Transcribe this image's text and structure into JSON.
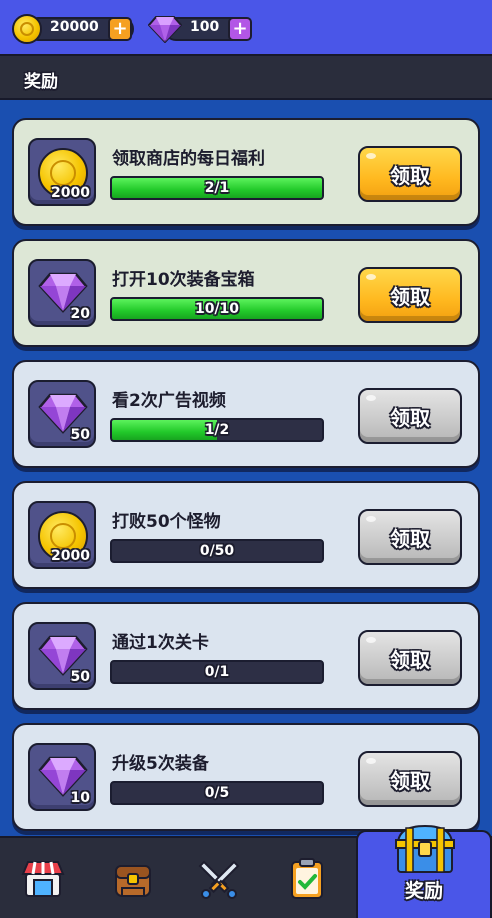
{
  "resources": {
    "coins": "20000",
    "gems": "100"
  },
  "header": {
    "title": "奖励"
  },
  "tasks": [
    {
      "title": "领取商店的每日福利",
      "reward_type": "coin",
      "reward_amount": "2000",
      "progress_text": "2/1",
      "progress": 1.0,
      "button_label": "领取",
      "claimable": true
    },
    {
      "title": "打开10次装备宝箱",
      "reward_type": "gem",
      "reward_amount": "20",
      "progress_text": "10/10",
      "progress": 1.0,
      "button_label": "领取",
      "claimable": true
    },
    {
      "title": "看2次广告视频",
      "reward_type": "gem",
      "reward_amount": "50",
      "progress_text": "1/2",
      "progress": 0.5,
      "button_label": "领取",
      "claimable": false
    },
    {
      "title": "打败50个怪物",
      "reward_type": "coin",
      "reward_amount": "2000",
      "progress_text": "0/50",
      "progress": 0.0,
      "button_label": "领取",
      "claimable": false
    },
    {
      "title": "通过1次关卡",
      "reward_type": "gem",
      "reward_amount": "50",
      "progress_text": "0/1",
      "progress": 0.0,
      "button_label": "领取",
      "claimable": false
    },
    {
      "title": "升级5次装备",
      "reward_type": "gem",
      "reward_amount": "10",
      "progress_text": "0/5",
      "progress": 0.0,
      "button_label": "领取",
      "claimable": false
    }
  ],
  "nav": {
    "items": [
      {
        "icon": "shop-icon"
      },
      {
        "icon": "backpack-icon"
      },
      {
        "icon": "crossed-swords-icon"
      },
      {
        "icon": "clipboard-check-icon"
      }
    ],
    "active": {
      "icon": "treasure-chest-icon",
      "label": "奖励"
    }
  },
  "colors": {
    "topbar": "#4a56e8",
    "claim_active": "#ffb81f",
    "claim_disabled": "#c9c9c9",
    "progress_fill": "#22c92a"
  }
}
